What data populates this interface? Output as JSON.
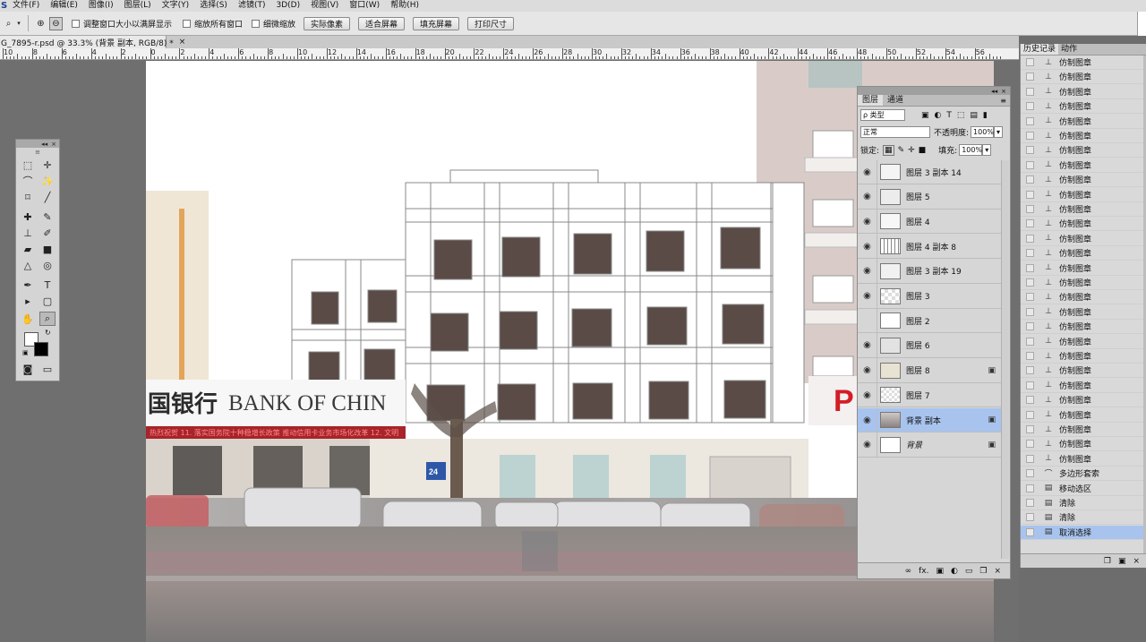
{
  "menu": {
    "items": [
      "文件(F)",
      "编辑(E)",
      "图像(I)",
      "图层(L)",
      "文字(Y)",
      "选择(S)",
      "滤镜(T)",
      "3D(D)",
      "视图(V)",
      "窗口(W)",
      "帮助(H)"
    ]
  },
  "options": {
    "resize_windows": "调整窗口大小以满屏显示",
    "zoom_all": "缩放所有窗口",
    "scrubby_zoom": "细微缩放",
    "actual_pixels": "实际像素",
    "fit_screen": "适合屏幕",
    "fill_screen": "填充屏幕",
    "print_size": "打印尺寸"
  },
  "document": {
    "tab_title": "G_7895-r.psd @ 33.3% (背景 副本, RGB/8) *",
    "close": "×"
  },
  "ruler": {
    "labels": [
      "10",
      "8",
      "6",
      "4",
      "2",
      "0",
      "2",
      "4",
      "6",
      "8",
      "10",
      "12",
      "14",
      "16",
      "18",
      "20",
      "22",
      "24",
      "26",
      "28",
      "30",
      "32",
      "34",
      "36",
      "38",
      "40",
      "42",
      "44",
      "46",
      "48",
      "50",
      "52",
      "54",
      "56"
    ]
  },
  "canvas": {
    "sign_text": "BANK OF CHIN",
    "sign_chinese": "国银行",
    "ticker_text": "热烈祝贺 11. 落实国务院十种稳增长政策 推动信用卡业务市场化改革 12. 文明",
    "branch_number": "24",
    "right_sign": "P"
  },
  "layers": {
    "tab_layers": "图层",
    "tab_channels": "通道",
    "filter_kind": "ρ 类型",
    "blend_mode": "正常",
    "opacity_label": "不透明度:",
    "opacity_value": "100%",
    "lock_label": "锁定:",
    "fill_label": "填充:",
    "fill_value": "100%",
    "items": [
      {
        "name": "图层 3 副本 14",
        "visible": true,
        "locked": false,
        "active": false
      },
      {
        "name": "图层 5",
        "visible": true,
        "locked": false,
        "active": false
      },
      {
        "name": "图层 4",
        "visible": true,
        "locked": false,
        "active": false
      },
      {
        "name": "图层 4 副本 8",
        "visible": true,
        "locked": false,
        "active": false
      },
      {
        "name": "图层 3 副本 19",
        "visible": true,
        "locked": false,
        "active": false
      },
      {
        "name": "图层 3",
        "visible": true,
        "locked": false,
        "active": false
      },
      {
        "name": "图层 2",
        "visible": false,
        "locked": false,
        "active": false
      },
      {
        "name": "图层 6",
        "visible": true,
        "locked": false,
        "active": false
      },
      {
        "name": "图层 8",
        "visible": true,
        "locked": true,
        "active": false
      },
      {
        "name": "图层 7",
        "visible": true,
        "locked": false,
        "active": false
      },
      {
        "name": "背景 副本",
        "visible": true,
        "locked": true,
        "active": true
      },
      {
        "name": "背景",
        "visible": true,
        "locked": true,
        "active": false
      }
    ],
    "footer_icons": [
      "link-icon",
      "fx-icon",
      "mask-icon",
      "adjustment-icon",
      "group-icon",
      "new-layer-icon",
      "trash-icon"
    ],
    "footer_fx": "fx."
  },
  "history": {
    "tab_history": "历史记录",
    "tab_actions": "动作",
    "items": [
      {
        "label": "仿制图章",
        "icon": "stamp-icon",
        "active": false
      },
      {
        "label": "仿制图章",
        "icon": "stamp-icon",
        "active": false
      },
      {
        "label": "仿制图章",
        "icon": "stamp-icon",
        "active": false
      },
      {
        "label": "仿制图章",
        "icon": "stamp-icon",
        "active": false
      },
      {
        "label": "仿制图章",
        "icon": "stamp-icon",
        "active": false
      },
      {
        "label": "仿制图章",
        "icon": "stamp-icon",
        "active": false
      },
      {
        "label": "仿制图章",
        "icon": "stamp-icon",
        "active": false
      },
      {
        "label": "仿制图章",
        "icon": "stamp-icon",
        "active": false
      },
      {
        "label": "仿制图章",
        "icon": "stamp-icon",
        "active": false
      },
      {
        "label": "仿制图章",
        "icon": "stamp-icon",
        "active": false
      },
      {
        "label": "仿制图章",
        "icon": "stamp-icon",
        "active": false
      },
      {
        "label": "仿制图章",
        "icon": "stamp-icon",
        "active": false
      },
      {
        "label": "仿制图章",
        "icon": "stamp-icon",
        "active": false
      },
      {
        "label": "仿制图章",
        "icon": "stamp-icon",
        "active": false
      },
      {
        "label": "仿制图章",
        "icon": "stamp-icon",
        "active": false
      },
      {
        "label": "仿制图章",
        "icon": "stamp-icon",
        "active": false
      },
      {
        "label": "仿制图章",
        "icon": "stamp-icon",
        "active": false
      },
      {
        "label": "仿制图章",
        "icon": "stamp-icon",
        "active": false
      },
      {
        "label": "仿制图章",
        "icon": "stamp-icon",
        "active": false
      },
      {
        "label": "仿制图章",
        "icon": "stamp-icon",
        "active": false
      },
      {
        "label": "仿制图章",
        "icon": "stamp-icon",
        "active": false
      },
      {
        "label": "仿制图章",
        "icon": "stamp-icon",
        "active": false
      },
      {
        "label": "仿制图章",
        "icon": "stamp-icon",
        "active": false
      },
      {
        "label": "仿制图章",
        "icon": "stamp-icon",
        "active": false
      },
      {
        "label": "仿制图章",
        "icon": "stamp-icon",
        "active": false
      },
      {
        "label": "仿制图章",
        "icon": "stamp-icon",
        "active": false
      },
      {
        "label": "仿制图章",
        "icon": "stamp-icon",
        "active": false
      },
      {
        "label": "仿制图章",
        "icon": "stamp-icon",
        "active": false
      },
      {
        "label": "多边形套索",
        "icon": "lasso-icon",
        "active": false
      },
      {
        "label": "移动选区",
        "icon": "doc-icon",
        "active": false
      },
      {
        "label": "清除",
        "icon": "doc-icon",
        "active": false
      },
      {
        "label": "清除",
        "icon": "doc-icon",
        "active": false
      },
      {
        "label": "取消选择",
        "icon": "doc-icon",
        "active": true
      }
    ]
  },
  "colors": {
    "accent_selection": "#a8c4ee",
    "bank_red": "#b01c22"
  }
}
